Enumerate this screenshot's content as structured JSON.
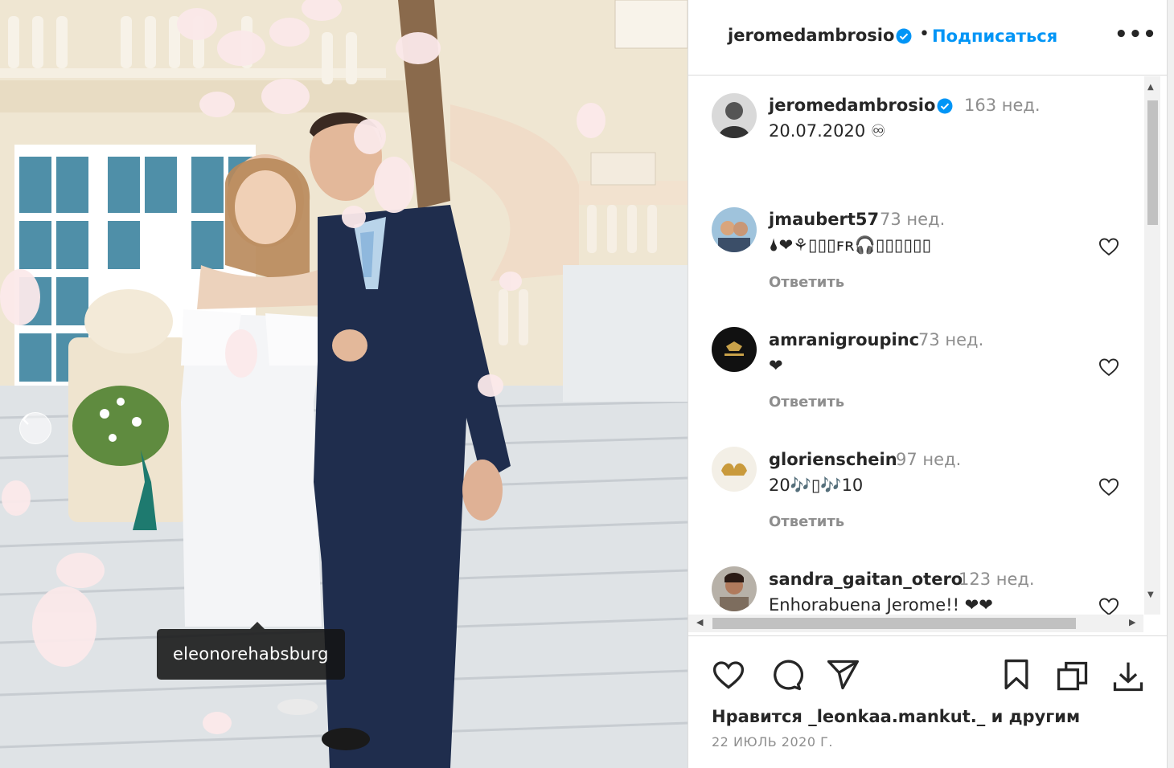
{
  "photo": {
    "tag_label": "eleonorehabsburg"
  },
  "header": {
    "username": "jeromedambrosio",
    "separator": "•",
    "follow_label": "Подписаться",
    "more_label": "•••"
  },
  "post": {
    "username": "jeromedambrosio",
    "age": "163 нед.",
    "caption": "20.07.2020 ♾"
  },
  "comments": [
    {
      "username": "jmaubert57",
      "age": "73 нед.",
      "text": "🌢❤⚘▯▯▯ꜰʀ🎧▯▯▯▯▯▯",
      "reply": "Ответить"
    },
    {
      "username": "amranigroupinc",
      "age": "73 нед.",
      "text": "❤",
      "reply": "Ответить"
    },
    {
      "username": "glorienschein",
      "age": "97 нед.",
      "text": "20🎶▯🎶10",
      "reply": "Ответить"
    },
    {
      "username": "sandra_gaitan_otero",
      "age": "123 нед.",
      "text": "Enhorabuena Jerome!! ❤❤"
    }
  ],
  "footer": {
    "likes_prefix": "Нравится",
    "likes_user": "_leonkaa.mankut._",
    "likes_suffix": "и другим",
    "date": "22 ИЮЛЬ 2020 Г."
  },
  "colors": {
    "accent": "#0095f6",
    "text": "#262626",
    "muted": "#8e8e8e",
    "border": "#dbdbdb"
  }
}
